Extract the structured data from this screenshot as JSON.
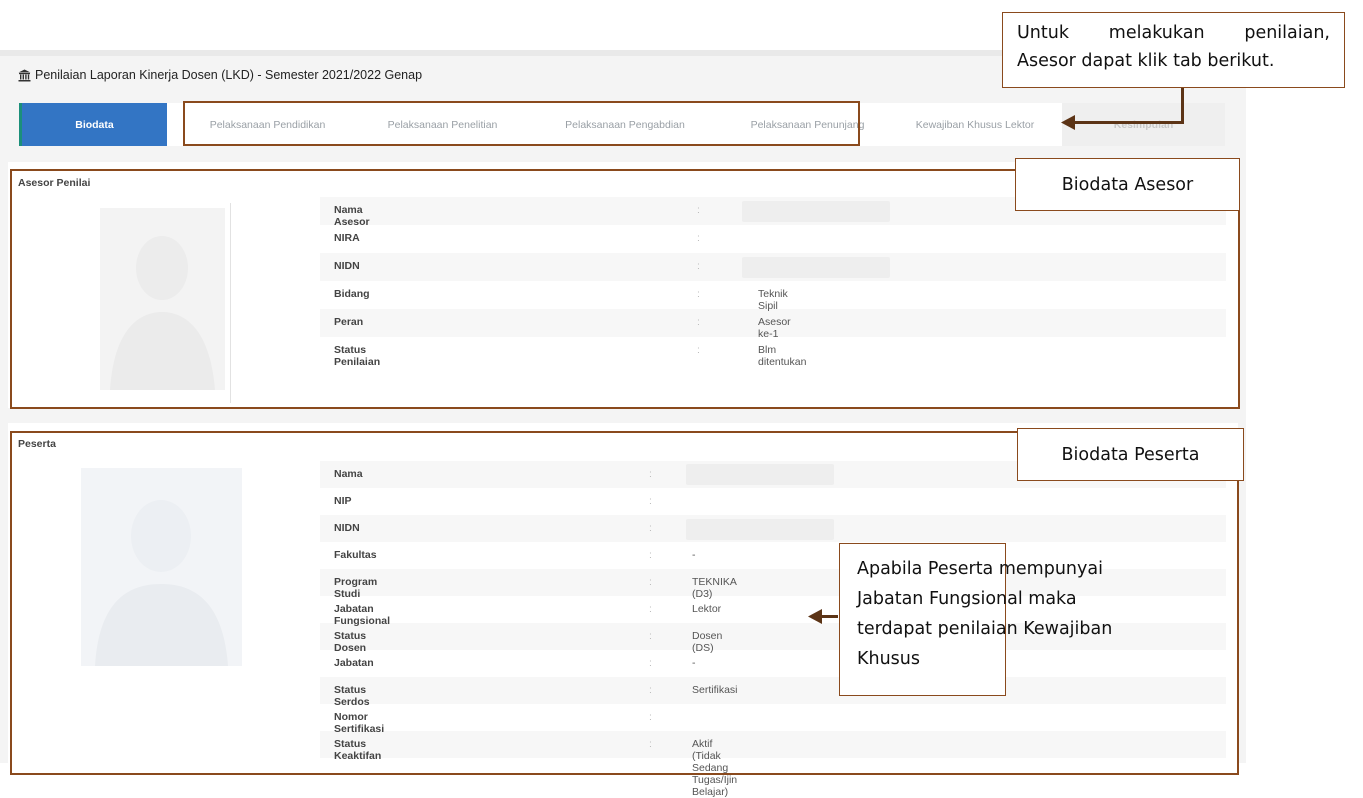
{
  "page": {
    "title": "Penilaian Laporan Kinerja Dosen (LKD) - Semester 2021/2022 Genap",
    "title_icon": "institution-icon"
  },
  "tabs": [
    {
      "label": "Biodata",
      "state": "active"
    },
    {
      "label": "Pelaksanaan Pendidikan",
      "state": "normal"
    },
    {
      "label": "Pelaksanaan Penelitian",
      "state": "normal"
    },
    {
      "label": "Pelaksanaan Pengabdian",
      "state": "normal"
    },
    {
      "label": "Pelaksanaan Penunjang",
      "state": "normal"
    },
    {
      "label": "Kewajiban Khusus Lektor",
      "state": "normal"
    },
    {
      "label": "Kesimpulan",
      "state": "disabled"
    }
  ],
  "asesor": {
    "title": "Asesor Penilai",
    "rows": [
      {
        "label": "Nama Asesor",
        "sep": ":",
        "value": ""
      },
      {
        "label": "NIRA",
        "sep": ":",
        "value": ""
      },
      {
        "label": "NIDN",
        "sep": ":",
        "value": ""
      },
      {
        "label": "Bidang",
        "sep": ":",
        "value": "Teknik Sipil"
      },
      {
        "label": "Peran",
        "sep": ":",
        "value": "Asesor ke-1"
      },
      {
        "label": "Status Penilaian",
        "sep": ":",
        "value": "Blm ditentukan"
      }
    ]
  },
  "peserta": {
    "title": "Peserta",
    "rows": [
      {
        "label": "Nama",
        "sep": ":",
        "value": ""
      },
      {
        "label": "NIP",
        "sep": ":",
        "value": ""
      },
      {
        "label": "NIDN",
        "sep": ":",
        "value": ""
      },
      {
        "label": "Fakultas",
        "sep": ":",
        "value": "-"
      },
      {
        "label": "Program Studi",
        "sep": ":",
        "value": "TEKNIKA (D3)"
      },
      {
        "label": "Jabatan Fungsional",
        "sep": ":",
        "value": "Lektor"
      },
      {
        "label": "Status Dosen",
        "sep": ":",
        "value": "Dosen (DS)"
      },
      {
        "label": "Jabatan",
        "sep": ":",
        "value": "-"
      },
      {
        "label": "Status Serdos",
        "sep": ":",
        "value": "Sertifikasi"
      },
      {
        "label": "Nomor Sertifikasi",
        "sep": ":",
        "value": ""
      },
      {
        "label": "Status Keaktifan",
        "sep": ":",
        "value": "Aktif (Tidak Sedang Tugas/Ijin Belajar)"
      }
    ]
  },
  "annotations": {
    "tabs_note_line1": "Untuk melakukan penilaian,",
    "tabs_note_line2": "Asesor dapat klik tab berikut.",
    "asesor_note": "Biodata Asesor",
    "peserta_note": "Biodata Peserta",
    "khusus_note_line1": "Apabila Peserta mempunyai",
    "khusus_note_line2": "Jabatan Fungsional maka",
    "khusus_note_line3": "terdapat penilaian  Kewajiban",
    "khusus_note_line4": "Khusus"
  },
  "colors": {
    "active_tab": "#3375c4",
    "annotation": "#8a4a1d"
  }
}
